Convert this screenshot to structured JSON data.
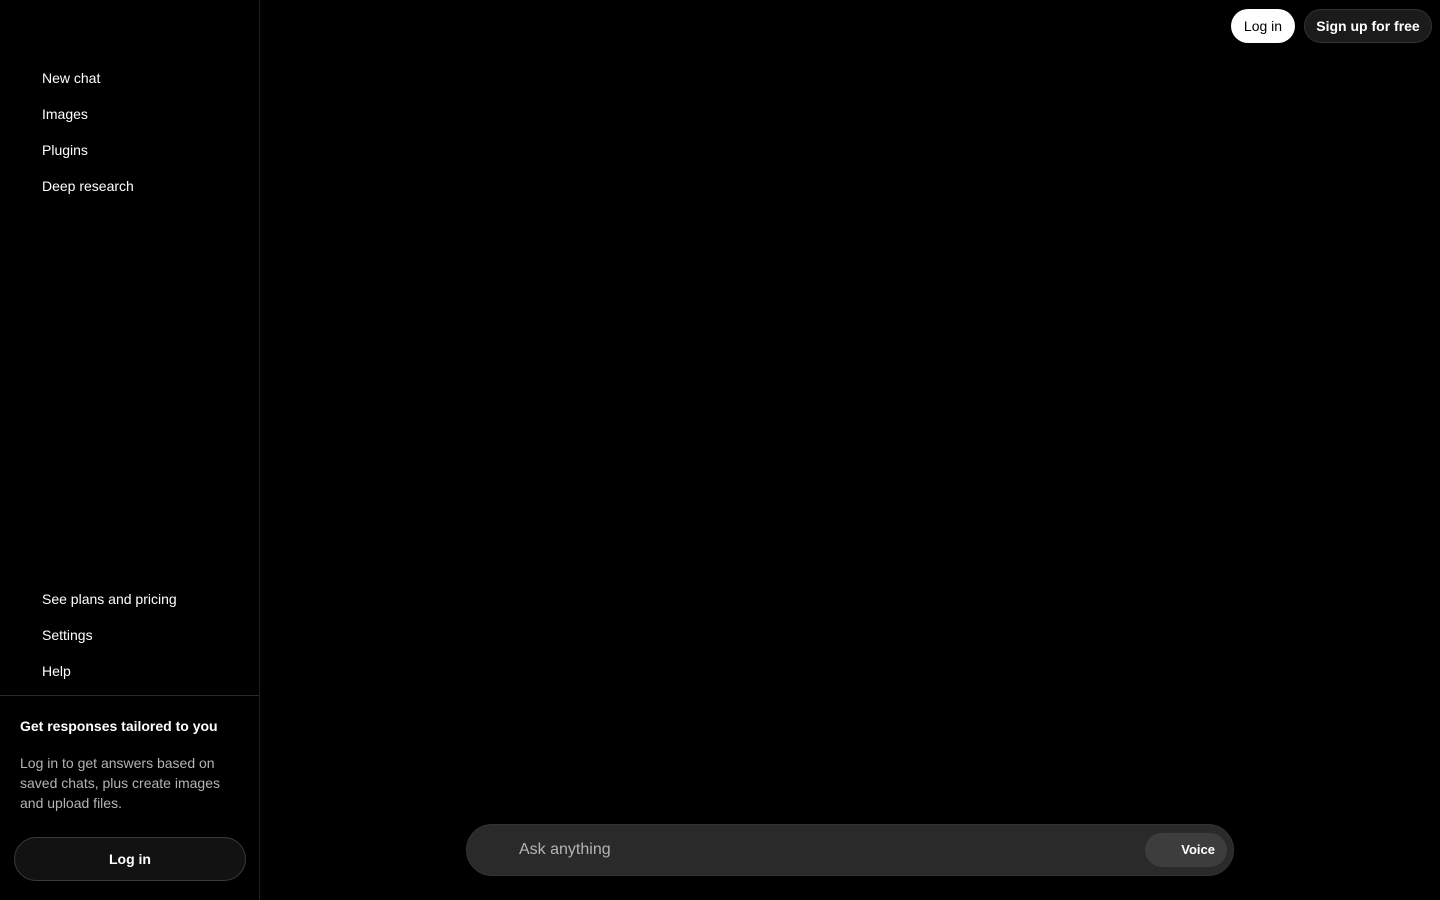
{
  "header": {
    "login_label": "Log in",
    "signup_label": "Sign up for free"
  },
  "sidebar": {
    "top_items": [
      {
        "label": "New chat"
      },
      {
        "label": "Images"
      },
      {
        "label": "Plugins"
      },
      {
        "label": "Deep research"
      }
    ],
    "bottom_items": [
      {
        "label": "See plans and pricing"
      },
      {
        "label": "Settings"
      },
      {
        "label": "Help"
      }
    ],
    "promo": {
      "title": "Get responses tailored to you",
      "body": "Log in to get answers based on saved chats, plus create images and upload files.",
      "login_label": "Log in"
    }
  },
  "composer": {
    "placeholder": "Ask anything",
    "voice_label": "Voice"
  },
  "colors": {
    "background": "#000000",
    "text": "#ffffff",
    "muted_text": "#b4b4b4",
    "composer_bg": "#2a2a2a"
  }
}
